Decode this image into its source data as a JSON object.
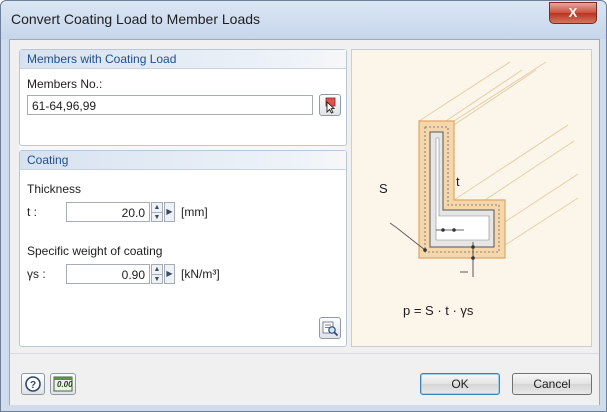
{
  "window": {
    "title": "Convert Coating Load to Member Loads",
    "close_label": "X"
  },
  "members_group": {
    "header": "Members with Coating Load",
    "members_label": "Members No.:",
    "members_value": "61-64,96,99"
  },
  "coating_group": {
    "header": "Coating",
    "thickness_heading": "Thickness",
    "t_label": "t :",
    "t_value": "20.0",
    "t_unit": "[mm]",
    "weight_heading": "Specific weight of coating",
    "ys_label": "γs :",
    "ys_value": "0.90",
    "ys_unit": "[kN/m³]"
  },
  "diagram": {
    "label_s": "S",
    "label_t": "t",
    "formula": "p = S · t · γs"
  },
  "buttons": {
    "ok": "OK",
    "cancel": "Cancel",
    "units_icon_text": "0.00"
  },
  "icons": {
    "help": "help-icon",
    "units": "decimal-places-icon",
    "pick": "select-members-cursor-icon",
    "view": "details-magnifier-icon"
  }
}
